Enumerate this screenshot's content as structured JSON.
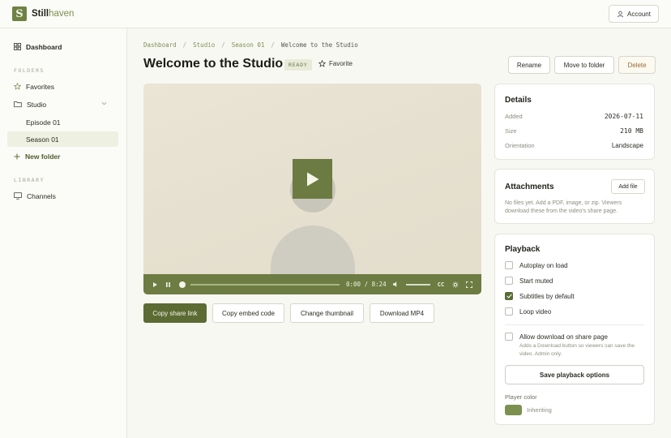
{
  "app": {
    "brand_a": "Still",
    "brand_b": "haven",
    "logo_letter": "S"
  },
  "header": {
    "account_label": "Account"
  },
  "sidebar": {
    "dashboard": "Dashboard",
    "folders_label": "FOLDERS",
    "favorites": "Favorites",
    "studio": "Studio",
    "episode": "Episode 01",
    "season": "Season 01",
    "new_folder": "New folder",
    "library_label": "LIBRARY",
    "channels": "Channels"
  },
  "breadcrumb": [
    "Dashboard",
    "Studio",
    "Season 01",
    "Welcome to the Studio"
  ],
  "page": {
    "title": "Welcome to the Studio",
    "status": "READY",
    "favorite_label": "Favorite",
    "rename": "Rename",
    "move": "Move to folder",
    "delete": "Delete"
  },
  "player": {
    "current_time": "0:00",
    "duration": "8:24",
    "time_sep": " / ",
    "cc": "CC",
    "progress": 0.0
  },
  "actions": {
    "share": "Copy share link",
    "embed": "Copy embed code",
    "thumbnail": "Change thumbnail",
    "download": "Download MP4"
  },
  "details": {
    "title": "Details",
    "added_label": "Added",
    "added_value": "2026-07-11",
    "size_label": "Size",
    "size_value": "210 MB",
    "orientation_label": "Orientation",
    "orientation_value": "Landscape"
  },
  "attachments": {
    "title": "Attachments",
    "add_label": "Add file",
    "help_1": "No files yet. Add a PDF, image, or zip. Viewers",
    "help_2": "download these from the video's share page."
  },
  "playback": {
    "title": "Playback",
    "autoplay": "Autoplay on load",
    "muted": "Start muted",
    "subtitles": "Subtitles by default",
    "loop": "Loop video",
    "allow_download": "Allow download on share page",
    "allow_help_1": "Adds a Download button so viewers can save the",
    "allow_help_2": "video. Admin only.",
    "save": "Save playback options",
    "color_label": "Player color",
    "color_state": "Inheriting",
    "color_value": "#7c9050"
  },
  "colors": {
    "accent": "#6b7b41",
    "accent_dark": "#5b6b33",
    "delete_text": "#9b6b35"
  }
}
